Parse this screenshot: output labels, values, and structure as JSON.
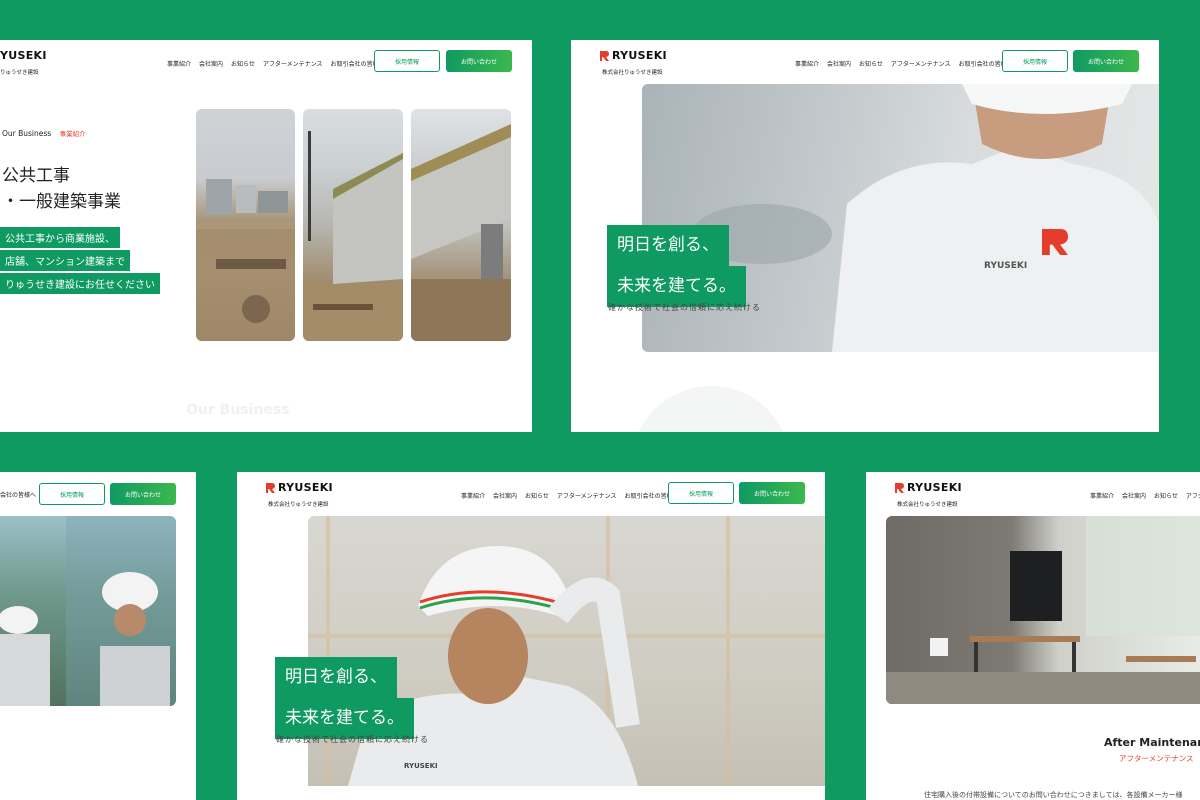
{
  "theme": {
    "accent": "#0f9a62",
    "red": "#e43d2b"
  },
  "brand": {
    "logo_text": "RYUSEKI",
    "logo_text_cut": "YUSEKI",
    "company_name": "株式会社りゅうせき建設",
    "company_name_cut": "りゅうせき建設",
    "jacket_logo_text": "RYUSEKI",
    "helmet_text": "RYUSEKI"
  },
  "nav": {
    "items": [
      "事業紹介",
      "会社案内",
      "お知らせ",
      "アフターメンテナンス",
      "お取引会社の皆様へ"
    ],
    "recruit_label": "採用情報",
    "contact_label": "お問い合わせ",
    "partner_cut": "会社の皆様へ"
  },
  "business": {
    "section_en": "Our Business",
    "section_ja": "事業紹介",
    "title_line1": "公共工事",
    "title_line2": "・一般建築事業",
    "desc_lines": [
      "公共工事から商業施設、",
      "店舗、マンション建築まで",
      "りゅうせき建設にお任せください"
    ],
    "watermark": "Our Business"
  },
  "hero": {
    "line1": "明日を創る、",
    "line2": "未来を建てる。",
    "sub": "確かな技術で社会の信頼に応え続ける"
  },
  "maintenance": {
    "title_en": "After Maintenar",
    "title_ja": "アフターメンテナンス",
    "body_cut": "住宅購入後の付帯設備についてのお問い合わせにつきましては、各設備メーカー様"
  }
}
